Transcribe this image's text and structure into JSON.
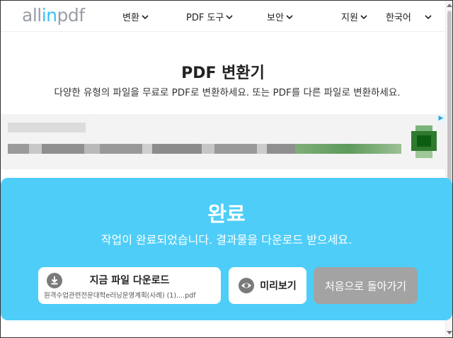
{
  "header": {
    "logo_prefix": "all",
    "logo_in": "in",
    "logo_suffix": "pdf",
    "nav": [
      {
        "label": "변환"
      },
      {
        "label": "PDF 도구"
      },
      {
        "label": "보안"
      },
      {
        "label": "지원"
      }
    ],
    "language": "한국어"
  },
  "main": {
    "title": "PDF 변환기",
    "subtitle": "다양한 유형의 파일을 무료로 PDF로 변환하세요. 또는 PDF를 다른 파일로 변환하세요."
  },
  "ad": {
    "choice_icon": "ad-choices-icon"
  },
  "result": {
    "title": "완료",
    "description": "작업이 완료되었습니다. 결과물을 다운로드 받으세요.",
    "download_label": "지금 파일 다운로드",
    "download_filename": "원격수업관련전문대학e러닝운영계획(사례) (1)....pdf",
    "preview_label": "미리보기",
    "restart_label": "처음으로 돌아가기"
  },
  "colors": {
    "accent": "#4dcdf7",
    "logo_accent": "#39c1f1",
    "restart_bg": "#a3a3a3"
  }
}
